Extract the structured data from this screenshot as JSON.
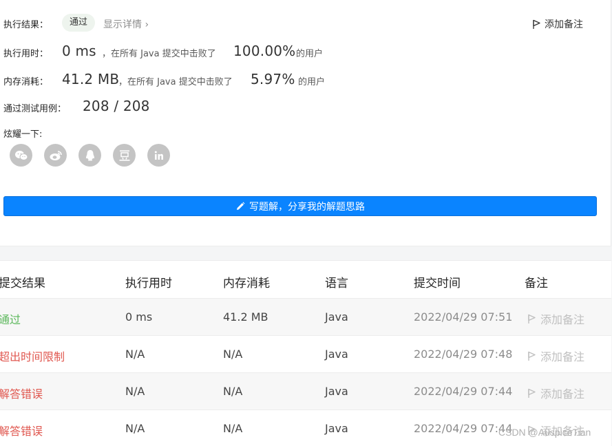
{
  "result": {
    "label": "执行结果：",
    "status": "通过",
    "details_link": "显示详情 ›",
    "add_note": "添加备注"
  },
  "runtime": {
    "label": "执行用时：",
    "value": "0 ms",
    "mid_text": "，在所有 Java 提交中击败了",
    "percent": "100.00%",
    "suffix": "的用户"
  },
  "memory": {
    "label": "内存消耗：",
    "value": "41.2 MB",
    "mid_text": "，在所有 Java 提交中击败了",
    "percent": "5.97%",
    "suffix": "的用户"
  },
  "testcases": {
    "label": "通过测试用例：",
    "value": "208 / 208"
  },
  "share": {
    "label": "炫耀一下:",
    "icons": [
      "wechat-icon",
      "weibo-icon",
      "qq-icon",
      "douban-icon",
      "linkedin-icon"
    ]
  },
  "write_button": "写题解，分享我的解题思路",
  "table": {
    "headers": [
      "提交结果",
      "执行用时",
      "内存消耗",
      "语言",
      "提交时间",
      "备注"
    ],
    "rows": [
      {
        "status": "通过",
        "kind": "pass",
        "time": "0 ms",
        "memory": "41.2 MB",
        "lang": "Java",
        "date": "2022/04/29 07:51",
        "note": "添加备注"
      },
      {
        "status": "超出时间限制",
        "kind": "fail",
        "time": "N/A",
        "memory": "N/A",
        "lang": "Java",
        "date": "2022/04/29 07:48",
        "note": "添加备注"
      },
      {
        "status": "解答错误",
        "kind": "fail",
        "time": "N/A",
        "memory": "N/A",
        "lang": "Java",
        "date": "2022/04/29 07:44",
        "note": "添加备注"
      },
      {
        "status": "解答错误",
        "kind": "fail",
        "time": "N/A",
        "memory": "N/A",
        "lang": "Java",
        "date": "2022/04/29 07:44",
        "note": "添加备注"
      }
    ]
  },
  "watermark": "CSDN @AuspiceTian",
  "colors": {
    "pass": "#5cb85c",
    "fail": "#e0574f",
    "primary": "#0a84ff"
  }
}
